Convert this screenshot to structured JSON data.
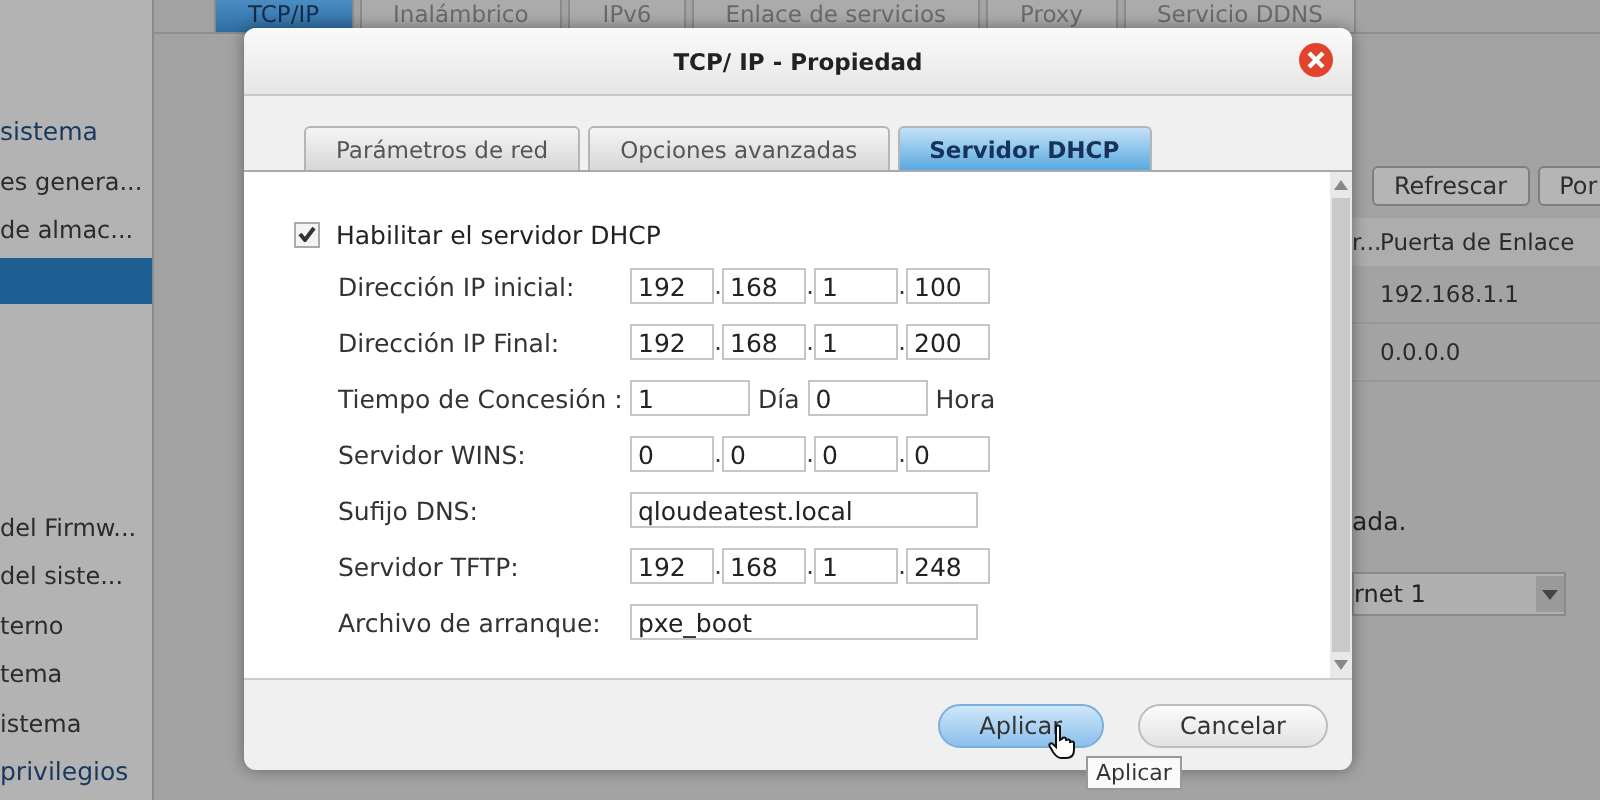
{
  "sidebar": {
    "items": [
      {
        "label": "sistema",
        "selected": false,
        "kind": "heading"
      },
      {
        "label": "es genera...",
        "selected": false,
        "kind": "item"
      },
      {
        "label": "de almac...",
        "selected": false,
        "kind": "item"
      },
      {
        "selected": true,
        "kind": "item"
      },
      {
        "label": "del Firmw...",
        "selected": false,
        "kind": "item"
      },
      {
        "label": "del siste...",
        "selected": false,
        "kind": "item"
      },
      {
        "label": "terno",
        "selected": false,
        "kind": "item"
      },
      {
        "label": "tema",
        "selected": false,
        "kind": "item"
      },
      {
        "label": "istema",
        "selected": false,
        "kind": "item"
      },
      {
        "label": "privilegios",
        "selected": false,
        "kind": "heading"
      }
    ]
  },
  "tabs": [
    {
      "label": "TCP/IP",
      "selected": true
    },
    {
      "label": "Inalámbrico",
      "selected": false
    },
    {
      "label": "IPv6",
      "selected": false
    },
    {
      "label": "Enlace de servicios",
      "selected": false
    },
    {
      "label": "Proxy",
      "selected": false
    },
    {
      "label": "Servicio DDNS",
      "selected": false
    }
  ],
  "background": {
    "buttons": [
      "Refrescar",
      "Por"
    ],
    "table": {
      "columns": [
        "r...",
        "Puerta de Enlace"
      ],
      "rows": [
        [
          "",
          "192.168.1.1"
        ],
        [
          "",
          "0.0.0.0"
        ]
      ]
    },
    "note": "ada.",
    "select": "rnet 1"
  },
  "dialog": {
    "title": "TCP/ IP - Propiedad",
    "tabs": [
      {
        "label": "Parámetros de red",
        "selected": false
      },
      {
        "label": "Opciones avanzadas",
        "selected": false
      },
      {
        "label": "Servidor DHCP",
        "selected": true
      }
    ],
    "enable": {
      "label": "Habilitar el servidor DHCP",
      "checked": true
    },
    "rows": [
      {
        "kind": "ip",
        "label": "Dirección IP inicial:",
        "separator": ".",
        "octets": [
          "192",
          "168",
          "1",
          "100"
        ]
      },
      {
        "kind": "ip",
        "label": "Dirección IP Final:",
        "separator": ".",
        "octets": [
          "192",
          "168",
          "1",
          "200"
        ]
      },
      {
        "kind": "lease",
        "label": "Tiempo de Concesión :",
        "parts": [
          {
            "value": "1",
            "unit": "Día"
          },
          {
            "value": "0",
            "unit": "Hora"
          }
        ]
      },
      {
        "kind": "ip",
        "label": "Servidor WINS:",
        "separator": ".",
        "octets": [
          "0",
          "0",
          "0",
          "0"
        ]
      },
      {
        "kind": "text",
        "label": "Sufijo DNS:",
        "value": "qloudeatest.local"
      },
      {
        "kind": "ip",
        "label": "Servidor TFTP:",
        "separator": ".",
        "octets": [
          "192",
          "168",
          "1",
          "248"
        ]
      },
      {
        "kind": "text",
        "label": "Archivo de arranque:",
        "value": "pxe_boot"
      }
    ],
    "buttons": [
      {
        "label": "Aplicar",
        "kind": "primary"
      },
      {
        "label": "Cancelar",
        "kind": "secondary"
      }
    ],
    "tooltip": "Aplicar"
  }
}
